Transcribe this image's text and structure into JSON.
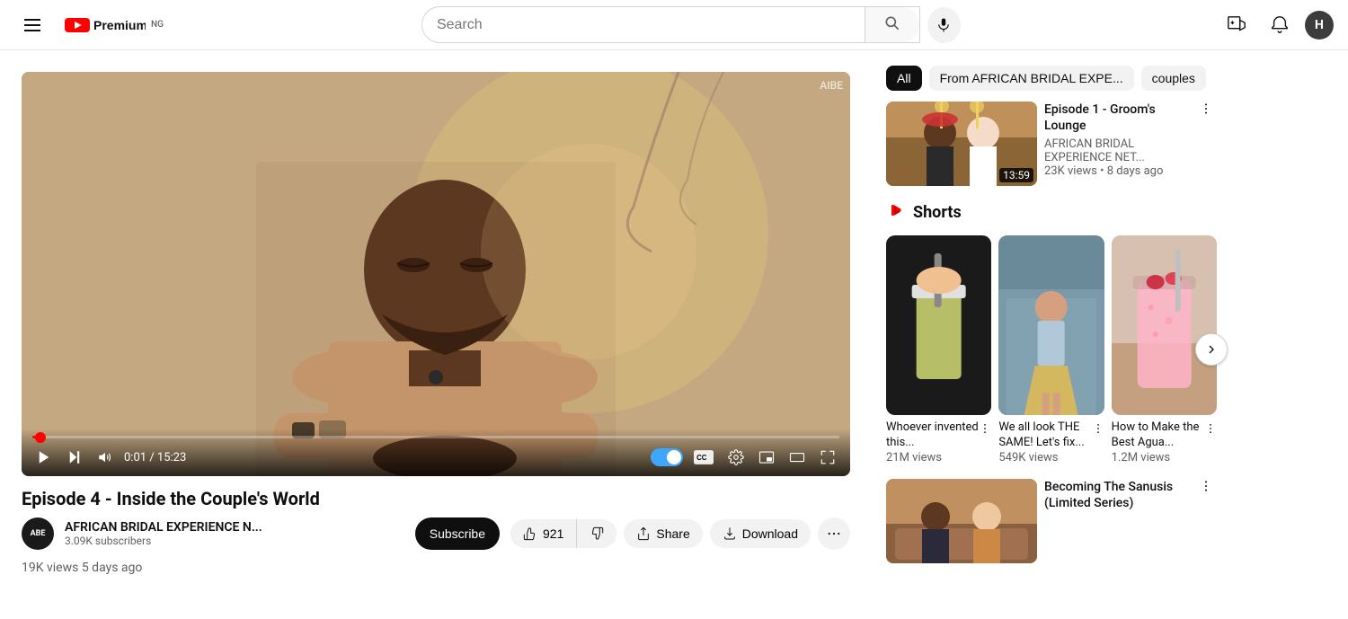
{
  "header": {
    "menu_label": "Menu",
    "logo_text": "Premium",
    "logo_badge": "NG",
    "search_placeholder": "Search",
    "create_label": "Create",
    "notifications_label": "Notifications",
    "avatar_initial": "H"
  },
  "video": {
    "title": "Episode 4 - Inside the Couple's World",
    "channel_name": "AFRICAN BRIDAL EXPERIENCE N...",
    "channel_initials": "ABE",
    "subscribers": "3.09K subscribers",
    "subscribe_label": "Subscribe",
    "views": "19K views",
    "upload_time": "5 days ago",
    "likes": "921",
    "current_time": "0:01",
    "total_time": "15:23",
    "watermark": "AIBE",
    "share_label": "Share",
    "download_label": "Download"
  },
  "filters": {
    "all_label": "All",
    "from_label": "From AFRICAN BRIDAL EXPE...",
    "couples_label": "couples"
  },
  "related_videos": [
    {
      "title": "Episode 1 - Groom's Lounge",
      "channel": "AFRICAN BRIDAL EXPERIENCE NET...",
      "views": "23K views",
      "upload_time": "8 days ago",
      "duration": "13:59",
      "thumb_color": "#8b6b45"
    }
  ],
  "shorts": {
    "section_title": "Shorts",
    "items": [
      {
        "title": "Whoever invented this...",
        "views": "21M views",
        "thumb_color1": "#c8b96a",
        "thumb_color2": "#1a1a1a"
      },
      {
        "title": "We all look THE SAME! Let's fix...",
        "views": "549K views",
        "thumb_color1": "#b0c4d4",
        "thumb_color2": "#6a8a9a"
      },
      {
        "title": "How to Make the Best Agua...",
        "views": "1.2M views",
        "thumb_color1": "#e8b4c0",
        "thumb_color2": "#c47080"
      }
    ]
  },
  "bottom_related": [
    {
      "title": "Becoming The Sanusis (Limited Series)",
      "thumb_color": "#c09060"
    }
  ]
}
